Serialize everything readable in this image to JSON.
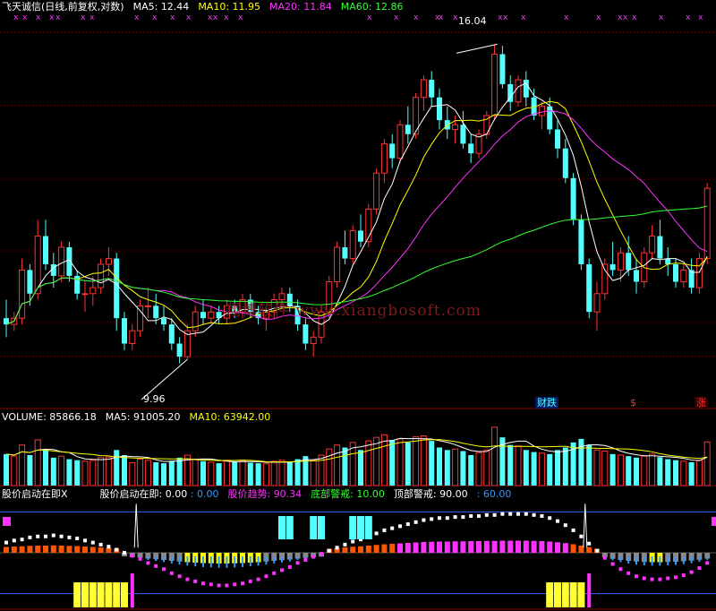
{
  "header": {
    "stock": "飞天诚信",
    "mode": "(日线,前复权,对数)",
    "ma5_label": "MA5:",
    "ma5": "12.44",
    "ma10_label": "MA10:",
    "ma10": "11.95",
    "ma20_label": "MA20:",
    "ma20": "11.84",
    "ma60_label": "MA60:",
    "ma60": "12.86"
  },
  "annotations": {
    "high": "16.04",
    "low": "9.96",
    "watermark": "翔博软件 www.xiangbosoft.com"
  },
  "markers": {
    "fin_drop": "财跌",
    "dollar": "$",
    "rise": "涨"
  },
  "volume_header": {
    "label": "VOLUME:",
    "value": "85866.18",
    "ma5_label": "MA5:",
    "ma5": "91005.20",
    "ma10_label": "MA10:",
    "ma10": "63942.00"
  },
  "indicator_header": {
    "name": "股价启动在即X",
    "p1_label": "股价启动在即:",
    "p1": "0.00",
    "p2": ": 0.00",
    "p3_label": "股价趋势:",
    "p3": "90.34",
    "p4_label": "底部警戒:",
    "p4": "10.00",
    "p5_label": "顶部警戒:",
    "p5": "90.00",
    "p6": ": 60.00"
  },
  "colors": {
    "up": "#ff3333",
    "down": "#54ffff",
    "ma5": "#ffffff",
    "ma10": "#ffff00",
    "ma20": "#ff33ff",
    "ma60": "#33ff33",
    "grid": "#8b0000"
  },
  "chart_data": {
    "type": "candlestick",
    "y_scale": "log",
    "ylim": [
      9.5,
      16.6
    ],
    "candles": [
      [
        10.6,
        10.9,
        10.3,
        10.5
      ],
      [
        10.5,
        10.7,
        10.4,
        10.6
      ],
      [
        10.6,
        11.6,
        10.5,
        11.4
      ],
      [
        11.4,
        11.5,
        10.8,
        11.0
      ],
      [
        11.0,
        12.3,
        10.9,
        12.0
      ],
      [
        12.0,
        12.3,
        11.4,
        11.5
      ],
      [
        11.5,
        11.7,
        11.1,
        11.3
      ],
      [
        11.3,
        11.9,
        11.2,
        11.8
      ],
      [
        11.8,
        11.9,
        11.2,
        11.3
      ],
      [
        11.3,
        11.4,
        10.9,
        11.0
      ],
      [
        11.0,
        11.2,
        10.7,
        11.0
      ],
      [
        11.0,
        11.3,
        10.8,
        11.1
      ],
      [
        11.1,
        11.6,
        11.0,
        11.5
      ],
      [
        11.5,
        11.8,
        11.3,
        11.6
      ],
      [
        11.6,
        11.7,
        10.4,
        10.6
      ],
      [
        10.6,
        10.7,
        10.1,
        10.2
      ],
      [
        10.2,
        10.5,
        10.1,
        10.4
      ],
      [
        10.4,
        10.9,
        10.3,
        10.8
      ],
      [
        10.8,
        11.1,
        10.6,
        10.8
      ],
      [
        10.8,
        11.0,
        10.5,
        10.6
      ],
      [
        10.6,
        10.8,
        10.4,
        10.5
      ],
      [
        10.5,
        10.6,
        10.1,
        10.2
      ],
      [
        10.2,
        10.3,
        9.9,
        10.0
      ],
      [
        10.0,
        10.5,
        9.96,
        10.4
      ],
      [
        10.4,
        10.8,
        10.3,
        10.7
      ],
      [
        10.7,
        10.9,
        10.5,
        10.6
      ],
      [
        10.6,
        10.8,
        10.5,
        10.7
      ],
      [
        10.7,
        10.8,
        10.5,
        10.6
      ],
      [
        10.6,
        10.9,
        10.5,
        10.8
      ],
      [
        10.8,
        10.9,
        10.6,
        10.7
      ],
      [
        10.7,
        11.0,
        10.6,
        10.9
      ],
      [
        10.9,
        11.0,
        10.6,
        10.7
      ],
      [
        10.7,
        10.8,
        10.5,
        10.6
      ],
      [
        10.6,
        10.8,
        10.4,
        10.7
      ],
      [
        10.7,
        11.0,
        10.6,
        10.9
      ],
      [
        10.9,
        11.1,
        10.8,
        11.0
      ],
      [
        11.0,
        11.1,
        10.7,
        10.8
      ],
      [
        10.8,
        10.9,
        10.4,
        10.5
      ],
      [
        10.5,
        10.6,
        10.1,
        10.2
      ],
      [
        10.2,
        10.4,
        10.0,
        10.3
      ],
      [
        10.3,
        10.8,
        10.2,
        10.7
      ],
      [
        10.7,
        11.3,
        10.6,
        11.2
      ],
      [
        11.2,
        11.9,
        11.1,
        11.8
      ],
      [
        11.8,
        12.1,
        11.5,
        11.6
      ],
      [
        11.6,
        12.2,
        11.5,
        12.1
      ],
      [
        12.1,
        12.4,
        11.8,
        11.9
      ],
      [
        11.9,
        12.6,
        11.8,
        12.5
      ],
      [
        12.5,
        13.3,
        12.4,
        13.2
      ],
      [
        13.2,
        13.9,
        13.0,
        13.8
      ],
      [
        13.8,
        14.0,
        13.3,
        13.5
      ],
      [
        13.5,
        14.3,
        13.4,
        14.2
      ],
      [
        14.2,
        14.6,
        13.8,
        14.0
      ],
      [
        14.0,
        14.9,
        13.9,
        14.8
      ],
      [
        14.8,
        15.3,
        14.5,
        15.2
      ],
      [
        15.2,
        15.4,
        14.6,
        14.8
      ],
      [
        14.8,
        15.0,
        14.1,
        14.3
      ],
      [
        14.3,
        14.6,
        13.9,
        14.1
      ],
      [
        14.1,
        14.4,
        13.8,
        14.2
      ],
      [
        14.2,
        14.5,
        13.7,
        13.8
      ],
      [
        13.8,
        14.0,
        13.4,
        13.6
      ],
      [
        13.6,
        14.1,
        13.5,
        14.0
      ],
      [
        14.0,
        14.5,
        13.9,
        14.4
      ],
      [
        14.4,
        16.04,
        14.3,
        15.8
      ],
      [
        15.8,
        16.0,
        15.0,
        15.1
      ],
      [
        15.1,
        15.3,
        14.5,
        14.7
      ],
      [
        14.7,
        15.3,
        14.6,
        15.2
      ],
      [
        15.2,
        15.4,
        14.6,
        14.8
      ],
      [
        14.8,
        15.0,
        14.3,
        14.4
      ],
      [
        14.4,
        14.7,
        14.1,
        14.6
      ],
      [
        14.6,
        14.8,
        14.0,
        14.1
      ],
      [
        14.1,
        14.3,
        13.5,
        13.7
      ],
      [
        13.7,
        13.9,
        13.0,
        13.1
      ],
      [
        13.1,
        13.2,
        12.2,
        12.3
      ],
      [
        12.3,
        12.4,
        11.4,
        11.5
      ],
      [
        11.5,
        11.6,
        10.6,
        10.7
      ],
      [
        10.7,
        11.2,
        10.4,
        11.0
      ],
      [
        11.0,
        11.6,
        10.9,
        11.5
      ],
      [
        11.5,
        11.9,
        11.3,
        11.4
      ],
      [
        11.4,
        11.8,
        11.2,
        11.7
      ],
      [
        11.7,
        12.0,
        11.3,
        11.4
      ],
      [
        11.4,
        11.6,
        11.0,
        11.2
      ],
      [
        11.2,
        11.8,
        11.1,
        11.7
      ],
      [
        11.7,
        12.2,
        11.6,
        12.0
      ],
      [
        12.0,
        12.3,
        11.5,
        11.6
      ],
      [
        11.6,
        11.8,
        11.3,
        11.5
      ],
      [
        11.5,
        11.6,
        11.1,
        11.2
      ],
      [
        11.2,
        11.5,
        11.1,
        11.4
      ],
      [
        11.4,
        11.6,
        11.0,
        11.1
      ],
      [
        11.1,
        11.7,
        11.0,
        11.6
      ],
      [
        11.6,
        13.0,
        11.5,
        12.9
      ]
    ],
    "volume": [
      62,
      58,
      80,
      60,
      90,
      70,
      55,
      58,
      52,
      50,
      48,
      50,
      55,
      56,
      70,
      60,
      45,
      52,
      50,
      46,
      44,
      48,
      55,
      60,
      52,
      48,
      46,
      44,
      50,
      47,
      50,
      45,
      44,
      43,
      48,
      50,
      46,
      52,
      58,
      50,
      60,
      72,
      80,
      75,
      85,
      70,
      88,
      95,
      100,
      90,
      92,
      85,
      96,
      98,
      88,
      75,
      70,
      72,
      68,
      60,
      65,
      70,
      115,
      95,
      80,
      78,
      70,
      66,
      64,
      62,
      70,
      75,
      85,
      92,
      80,
      70,
      68,
      62,
      60,
      58,
      55,
      58,
      62,
      56,
      52,
      50,
      48,
      46,
      50,
      86
    ],
    "indicator": {
      "trend": [
        60,
        62,
        63,
        65,
        66,
        66,
        67,
        66,
        65,
        64,
        62,
        60,
        58,
        56,
        53,
        50,
        47,
        44,
        40,
        37,
        34,
        30,
        27,
        24,
        22,
        20,
        19,
        18,
        18,
        19,
        20,
        22,
        24,
        27,
        30,
        33,
        36,
        40,
        43,
        46,
        49,
        52,
        55,
        58,
        61,
        63,
        66,
        69,
        72,
        74,
        76,
        78,
        80,
        82,
        83,
        84,
        84,
        85,
        85,
        86,
        86,
        87,
        87,
        88,
        88,
        88,
        88,
        87,
        86,
        84,
        81,
        77,
        72,
        66,
        59,
        52,
        45,
        39,
        34,
        30,
        27,
        25,
        24,
        24,
        25,
        26,
        28,
        31,
        35,
        40
      ],
      "bottom_alert": 10.0,
      "top_alert": 90.0,
      "start_signal": 0.0,
      "trend_last": 90.34
    }
  }
}
